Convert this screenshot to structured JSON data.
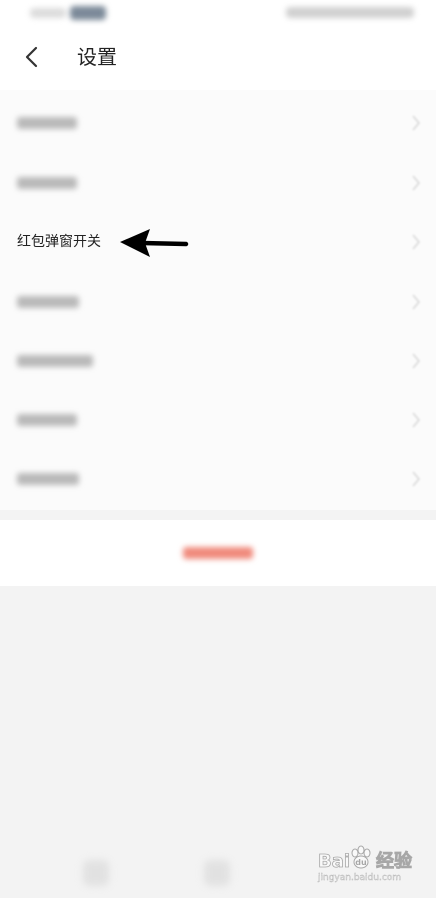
{
  "header": {
    "title": "设置",
    "back_icon": "chevron-left-icon"
  },
  "settings": {
    "items": [
      {
        "label": "",
        "blurred": true
      },
      {
        "label": "",
        "blurred": true
      },
      {
        "label": "红包弹窗开关",
        "blurred": false
      },
      {
        "label": "",
        "blurred": true
      },
      {
        "label": "",
        "blurred": true
      },
      {
        "label": "",
        "blurred": true
      },
      {
        "label": "",
        "blurred": true
      }
    ]
  },
  "logout": {
    "label": ""
  },
  "annotation": {
    "icon": "arrow-left-icon",
    "color": "#000000"
  },
  "watermark": {
    "brand": "Bai",
    "brand_suffix": "经验",
    "url": "jingyan.baidu.com"
  },
  "colors": {
    "accent": "#f27a6b",
    "text": "#222222",
    "background": "#f3f3f3"
  }
}
